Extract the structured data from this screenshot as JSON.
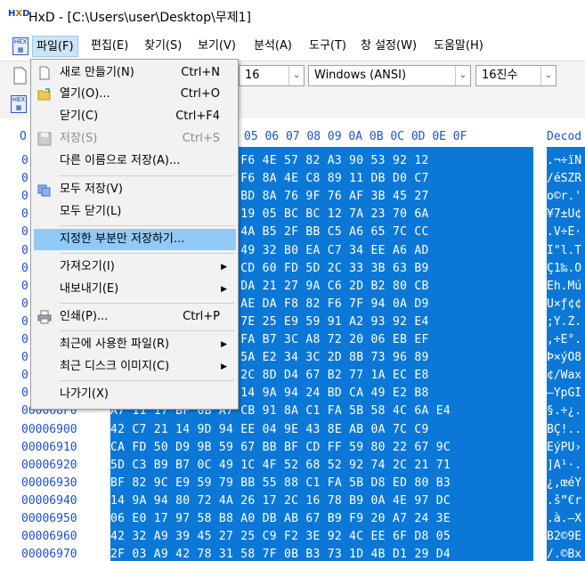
{
  "window": {
    "title": "HxD - [C:\\Users\\user\\Desktop\\무제1]"
  },
  "menubar": {
    "items": [
      {
        "label": "파일(F)"
      },
      {
        "label": "편집(E)"
      },
      {
        "label": "찾기(S)"
      },
      {
        "label": "보기(V)"
      },
      {
        "label": "분석(A)"
      },
      {
        "label": "도구(T)"
      },
      {
        "label": "창 설정(W)"
      },
      {
        "label": "도움말(H)"
      }
    ]
  },
  "toolbar": {
    "bytes_per_row": "16",
    "charset": "Windows (ANSI)",
    "offset_base": "16진수"
  },
  "file_menu": {
    "items": [
      {
        "label": "새로 만들기(N)",
        "shortcut": "Ctrl+N"
      },
      {
        "label": "열기(O)...",
        "shortcut": "Ctrl+O"
      },
      {
        "label": "닫기(C)",
        "shortcut": "Ctrl+F4"
      },
      {
        "label": "저장(S)",
        "shortcut": "Ctrl+S"
      },
      {
        "label": "다른 이름으로 저장(A)..."
      },
      {
        "label": "모두 저장(V)"
      },
      {
        "label": "모두 닫기(L)"
      },
      {
        "label": "지정한 부분만 저장하기..."
      },
      {
        "label": "가져오기(I)"
      },
      {
        "label": "내보내기(E)"
      },
      {
        "label": "인쇄(P)...",
        "shortcut": "Ctrl+P"
      },
      {
        "label": "최근에 사용한 파일(R)"
      },
      {
        "label": "최근 디스크 이미지(C)"
      },
      {
        "label": "나가기(X)"
      }
    ]
  },
  "hex_view": {
    "column_header_offset": "O",
    "column_header_hex": "05 06 07 08 09 0A 0B 0C 0D 0E 0F",
    "column_header_text": "Decod",
    "rows": [
      {
        "offset": "0",
        "hex": "            00 6A F6 4E 57 82 A3 90 53 92 12",
        "text": ".¬÷ïN"
      },
      {
        "offset": "0",
        "hex": "            93 52 F6 8A 4E C8 89 11 DB D0 C7",
        "text": "/éSŽR"
      },
      {
        "offset": "0",
        "hex": "            BF 91 BD 8A 76 9F 76 AF 3B 45 27",
        "text": "o©r.'"
      },
      {
        "offset": "0",
        "hex": "            0B 89 19 05 BC BC 12 7A 23 70 6A",
        "text": "¥7±Ü¢"
      },
      {
        "offset": "0",
        "hex": "            8A 2A 4A B5 2F BB C5 A6 65 7C CC",
        "text": ".V÷Ê·"
      },
      {
        "offset": "0",
        "hex": "            A1 49 49 32 B0 EA C7 34 EE A6 AD",
        "text": "Î\"l.T"
      },
      {
        "offset": "0",
        "hex": "            69 6F CD 60 FD 5D 2C 33 3B 63 B9",
        "text": "Ç1‰.Ó"
      },
      {
        "offset": "0",
        "hex": "            7B 5F DA 21 27 9A C6 2D B2 80 CB",
        "text": "Ëh.Mú"
      },
      {
        "offset": "0",
        "hex": "            A4 EF AE DA F8 82 F6 7F 94 0A D9",
        "text": "Ü×ƒ¢¢"
      },
      {
        "offset": "0",
        "hex": "            8A 0D 7E 25 E9 59 91 A2 93 92 E4",
        "text": ";Ý.Ž."
      },
      {
        "offset": "0",
        "hex": "            EC EC FA B7 3C A8 72 20 06 EB EF",
        "text": ",÷Ê°."
      },
      {
        "offset": "0",
        "hex": "            68 52 5A E2 34 3C 2D 8B 73 96 89",
        "text": "Þ×ýÒ8"
      },
      {
        "offset": "0",
        "hex": "            5F FC 2C 8D D4 67 B2 77 1A EC E8",
        "text": "¢/Wax"
      },
      {
        "offset": "0",
        "hex": "            CA DE 14 9A 94 24 BD CA 49 E2 B8",
        "text": "—ŸpGÍ"
      },
      {
        "offset": "000068F0",
        "hex": "A7 11 17 BF 0B A7 CB 91 8A C1 FA 5B 58 4C 6A E4",
        "text": "§.÷¿."
      },
      {
        "offset": "00006900",
        "hex": "42 C7 21 14 9D 94 EE 04 9E 43 8E AB 0A 7C C9",
        "text": "BÇ!.."
      },
      {
        "offset": "00006910",
        "hex": "CA FD 50 D9 9B 59 67 BB BF CD FF 59 80 22 67 9C",
        "text": "ÊýPÙ›"
      },
      {
        "offset": "00006920",
        "hex": "5D C3 B9 B7 0C 49 1C 4F 52 68 52 92 74 2C 21 71",
        "text": "]Ã¹·."
      },
      {
        "offset": "00006930",
        "hex": "BF 82 9C E9 59 79 BB 55 88 C1 FA 5B D8 ED 80 B3",
        "text": "¿‚œéY"
      },
      {
        "offset": "00006940",
        "hex": "14 9A 94 80 72 4A 26 17 2C 16 78 B9 0A 4E 97 DC",
        "text": ".š”€r"
      },
      {
        "offset": "00006950",
        "hex": "06 E0 17 97 58 B8 A0 DB AB 67 B9 F9 20 A7 24 3E",
        "text": ".à.—X"
      },
      {
        "offset": "00006960",
        "hex": "42 32 A9 39 45 27 25 C9 F2 3E 92 4C EE 6F D8 05",
        "text": "B2©9E"
      },
      {
        "offset": "00006970",
        "hex": "2F 03 A9 42 78 31 58 7F 0B B3 73 1D 4B D1 29 D4",
        "text": "/.©Bx"
      }
    ]
  },
  "colors": {
    "selection": "#0b78d7",
    "offset_text": "#1f4fd1",
    "menu_highlight": "#91c9f7"
  }
}
